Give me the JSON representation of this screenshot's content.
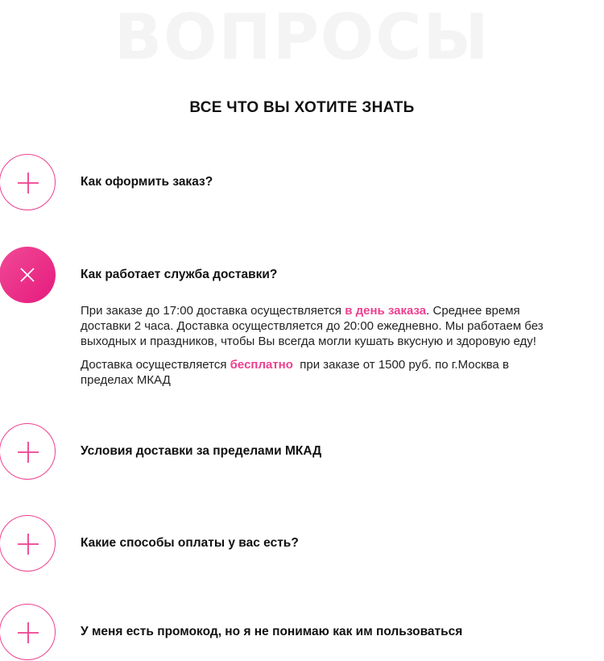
{
  "header": {
    "watermark": "ВОПРОСЫ",
    "subtitle": "ВСЕ ЧТО ВЫ ХОТИТЕ ЗНАТЬ"
  },
  "colors": {
    "accent": "#ee3f8f",
    "text": "#111111",
    "watermark": "#f4f4f4"
  },
  "faq": [
    {
      "question": "Как оформить заказ?",
      "state": "collapsed",
      "icon": "plus-icon"
    },
    {
      "question": "Как работает служба доставки?",
      "state": "expanded",
      "icon": "close-icon",
      "answer": {
        "p1_before": "При заказе до 17:00 доставка осуществляется ",
        "p1_highlight": "в день заказа",
        "p1_after": ". Среднее время доставки 2 часа. Доставка осуществляется до 20:00 ежедневно. Мы работаем без выходных и праздников, чтобы Вы всегда могли кушать вкусную и здоровую еду!",
        "p2_before": "Доставка осуществляется ",
        "p2_highlight": "бесплатно",
        "p2_after": "  при заказе от 1500 руб. по г.Москва в пределах МКАД"
      }
    },
    {
      "question": "Условия доставки за пределами МКАД",
      "state": "collapsed",
      "icon": "plus-icon"
    },
    {
      "question": "Какие способы оплаты у вас есть?",
      "state": "collapsed",
      "icon": "plus-icon"
    },
    {
      "question": "У меня есть промокод, но я не понимаю как им пользоваться",
      "state": "collapsed",
      "icon": "plus-icon"
    }
  ]
}
